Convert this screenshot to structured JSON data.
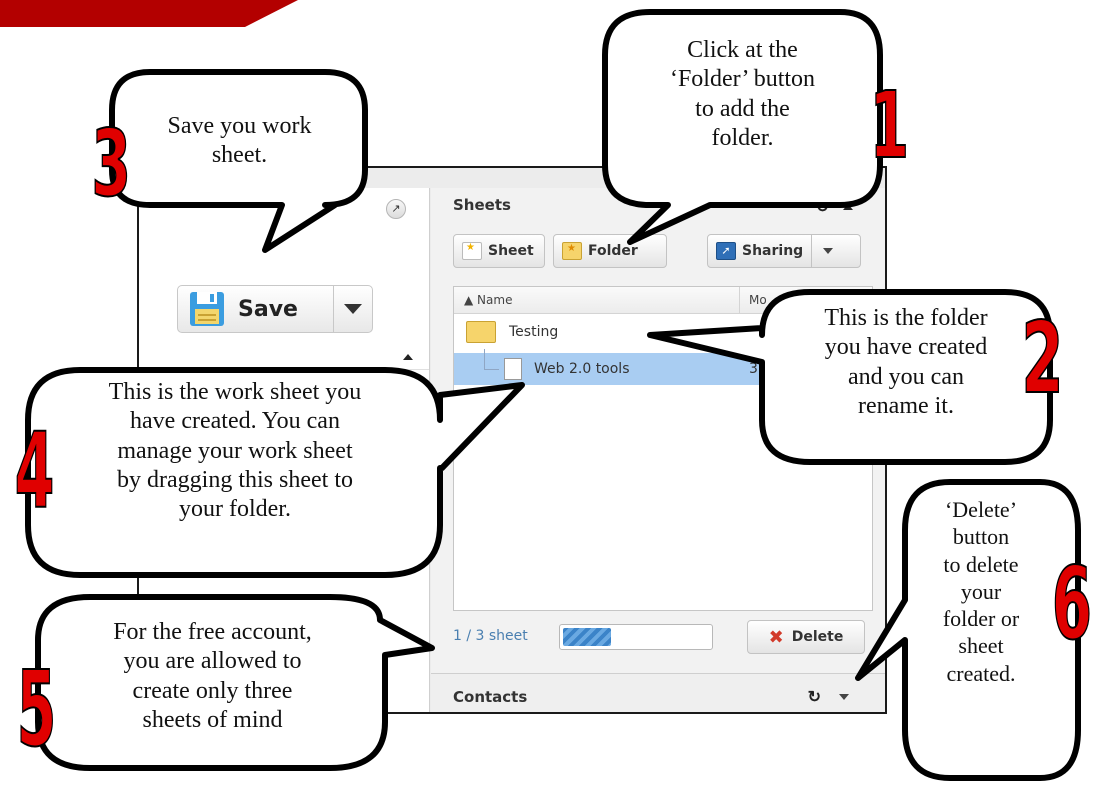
{
  "colors": {
    "accent_red": "#e00000",
    "selection_blue": "#a9cdf2",
    "bar_blue": "#3b83c8"
  },
  "app": {
    "save_label": "Save",
    "sheets": {
      "title": "Sheets",
      "buttons": {
        "sheet": "Sheet",
        "folder": "Folder",
        "sharing": "Sharing"
      },
      "columns": {
        "name": "Name",
        "modified": "Mo"
      },
      "rows": [
        {
          "name": "Testing",
          "type": "folder",
          "date": ""
        },
        {
          "name": "Web 2.0 tools",
          "type": "sheet",
          "date": "3r"
        }
      ],
      "status": "1 / 3 sheet",
      "usage_fraction": 0.33,
      "delete_label": "Delete"
    },
    "contacts": {
      "title": "Contacts"
    }
  },
  "callouts": {
    "c1": {
      "number": "1",
      "lines": [
        "Click at the",
        "‘Folder’ button",
        "to add the",
        "folder."
      ]
    },
    "c2": {
      "number": "2",
      "lines": [
        "This is the folder",
        "you have created",
        "and you can",
        "rename it."
      ]
    },
    "c3": {
      "number": "3",
      "lines": [
        "Save you work",
        "sheet."
      ]
    },
    "c4": {
      "number": "4",
      "lines": [
        "This is the work sheet you",
        "have created. You can",
        "manage your work sheet",
        "by dragging this sheet to",
        "your folder."
      ]
    },
    "c5": {
      "number": "5",
      "lines": [
        "For the free account,",
        "you are allowed to",
        "create only three",
        "sheets of mind"
      ]
    },
    "c6": {
      "number": "6",
      "lines": [
        "‘Delete’",
        "button",
        "to delete",
        "your",
        "folder or",
        "sheet",
        "created."
      ]
    }
  }
}
